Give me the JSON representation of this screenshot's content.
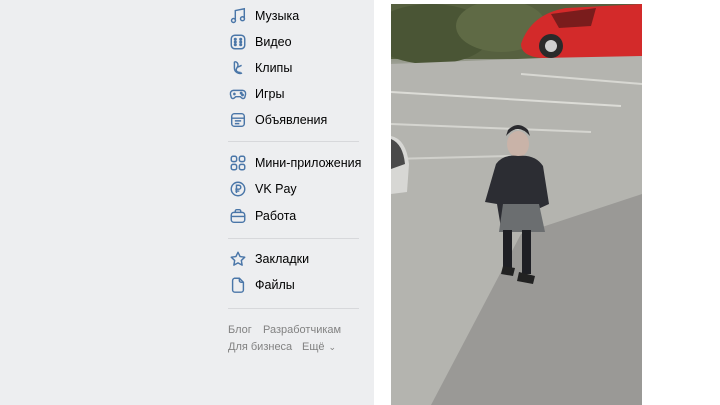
{
  "sidebar": {
    "items": [
      {
        "label": "Музыка",
        "icon": "music-icon"
      },
      {
        "label": "Видео",
        "icon": "video-icon"
      },
      {
        "label": "Клипы",
        "icon": "clips-icon"
      },
      {
        "label": "Игры",
        "icon": "gamepad-icon"
      },
      {
        "label": "Объявления",
        "icon": "classifieds-icon"
      },
      {
        "label": "Мини-приложения",
        "icon": "apps-grid-icon"
      },
      {
        "label": "VK Pay",
        "icon": "vkpay-icon"
      },
      {
        "label": "Работа",
        "icon": "briefcase-icon"
      },
      {
        "label": "Закладки",
        "icon": "star-icon"
      },
      {
        "label": "Файлы",
        "icon": "file-icon"
      }
    ]
  },
  "footer": {
    "blog": "Блог",
    "developers": "Разработчикам",
    "business": "Для бизнеса",
    "more": "Ещё"
  },
  "colors": {
    "accent": "#4a76a8",
    "background": "#edeef0",
    "muted": "#828282"
  }
}
